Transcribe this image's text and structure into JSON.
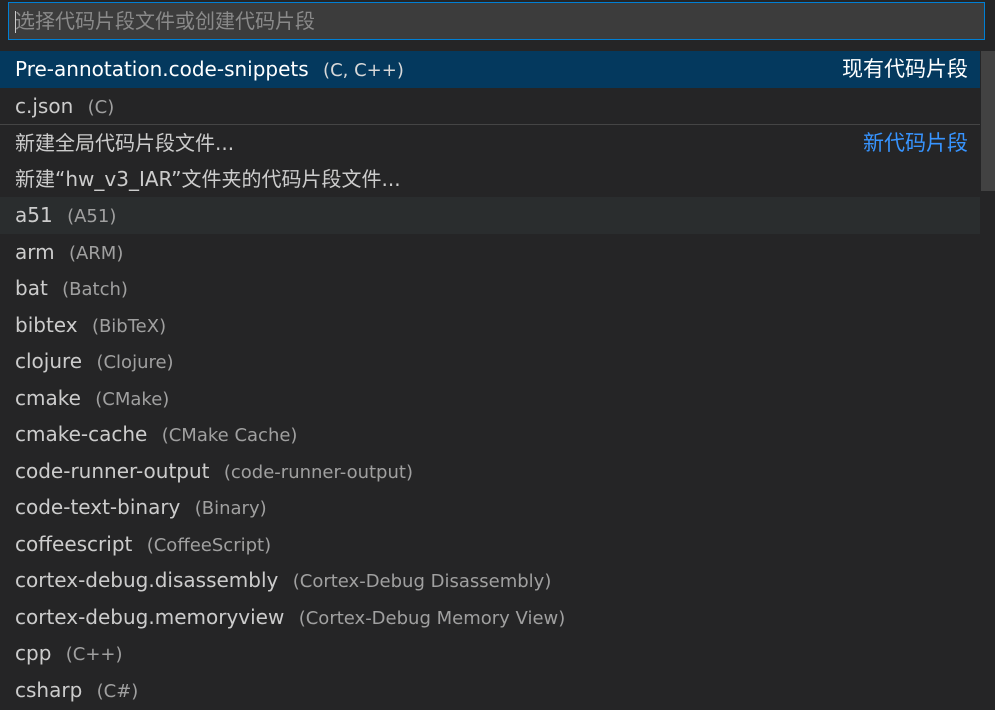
{
  "search": {
    "placeholder": "选择代码片段文件或创建代码片段",
    "value": ""
  },
  "items": [
    {
      "label": "Pre-annotation.code-snippets",
      "description": "(C, C++)",
      "group": "现有代码片段"
    },
    {
      "label": "c.json",
      "description": "(C)",
      "group": ""
    },
    {
      "label": "新建全局代码片段文件...",
      "description": "",
      "group": "新代码片段"
    },
    {
      "label": "新建“hw_v3_IAR”文件夹的代码片段文件...",
      "description": "",
      "group": ""
    },
    {
      "label": "a51",
      "description": "(A51)",
      "group": ""
    },
    {
      "label": "arm",
      "description": "(ARM)",
      "group": ""
    },
    {
      "label": "bat",
      "description": "(Batch)",
      "group": ""
    },
    {
      "label": "bibtex",
      "description": "(BibTeX)",
      "group": ""
    },
    {
      "label": "clojure",
      "description": "(Clojure)",
      "group": ""
    },
    {
      "label": "cmake",
      "description": "(CMake)",
      "group": ""
    },
    {
      "label": "cmake-cache",
      "description": "(CMake Cache)",
      "group": ""
    },
    {
      "label": "code-runner-output",
      "description": "(code-runner-output)",
      "group": ""
    },
    {
      "label": "code-text-binary",
      "description": "(Binary)",
      "group": ""
    },
    {
      "label": "coffeescript",
      "description": "(CoffeeScript)",
      "group": ""
    },
    {
      "label": "cortex-debug.disassembly",
      "description": "(Cortex-Debug Disassembly)",
      "group": ""
    },
    {
      "label": "cortex-debug.memoryview",
      "description": "(Cortex-Debug Memory View)",
      "group": ""
    },
    {
      "label": "cpp",
      "description": "(C++)",
      "group": ""
    },
    {
      "label": "csharp",
      "description": "(C#)",
      "group": ""
    }
  ],
  "colors": {
    "selected_bg": "#04395e",
    "focus_border": "#007fd4",
    "group_link": "#3794ff"
  }
}
